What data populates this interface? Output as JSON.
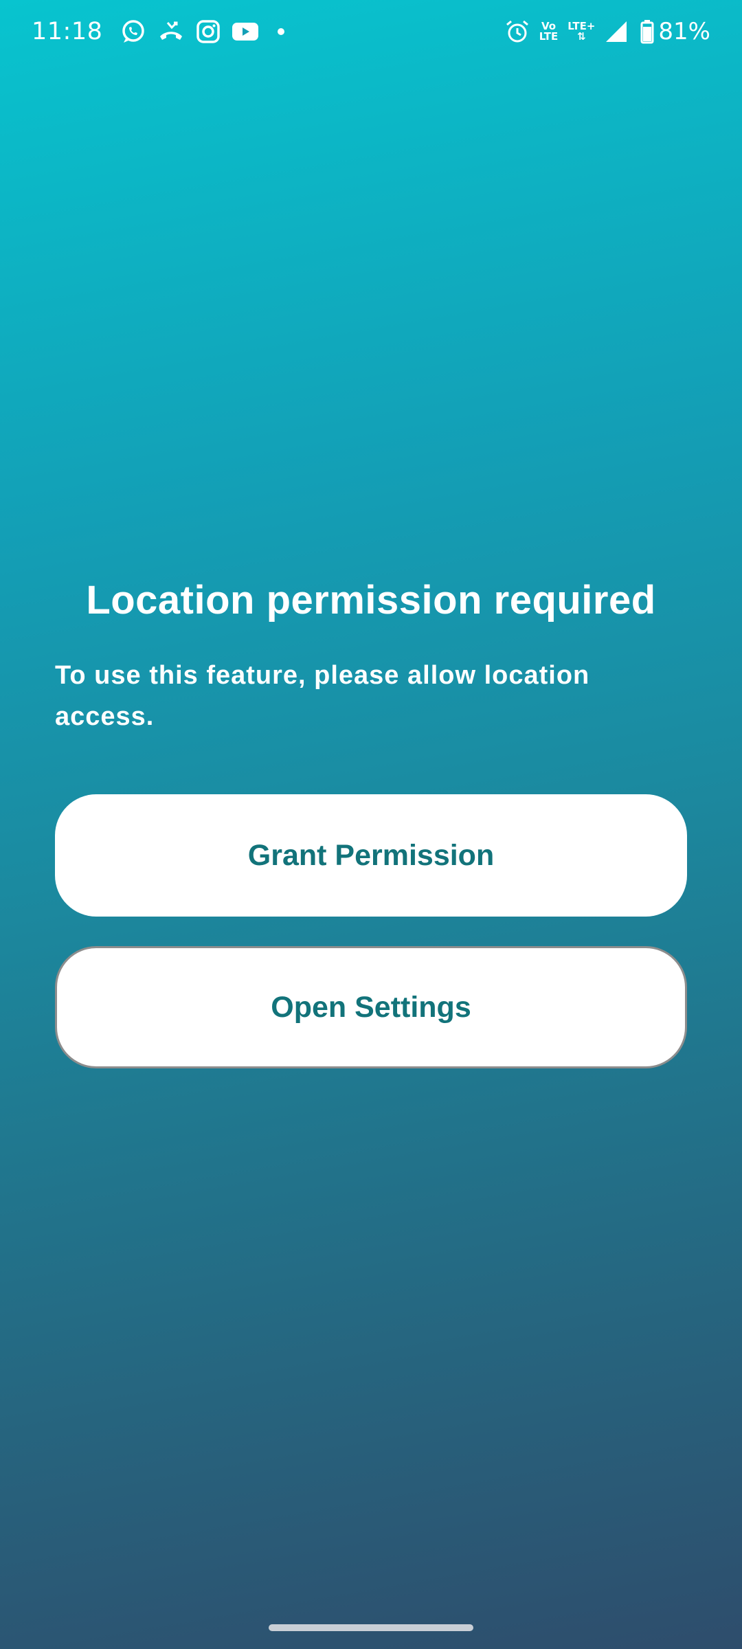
{
  "status_bar": {
    "time": "11:18",
    "notification_icons": [
      "whatsapp-icon",
      "missed-call-icon",
      "instagram-icon",
      "youtube-icon",
      "dot-icon"
    ],
    "system_icons": [
      "alarm-icon",
      "volte-icon",
      "lte-plus-icon",
      "signal-icon",
      "battery-icon"
    ],
    "volte_label_top": "Vo",
    "volte_label_bottom": "LTE",
    "lte_label": "LTE+",
    "battery_percent": "81%"
  },
  "main": {
    "title": "Location permission required",
    "message": "To use this feature, please allow location access.",
    "grant_button_label": "Grant Permission",
    "settings_button_label": "Open Settings"
  },
  "colors": {
    "gradient_top": "#08c4cf",
    "gradient_bottom": "#2e4d6c",
    "button_background": "#ffffff",
    "button_text": "#12737a",
    "settings_button_border": "#8d8d8d"
  }
}
